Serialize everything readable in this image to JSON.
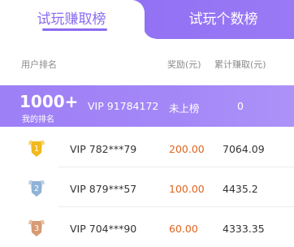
{
  "tabs": {
    "active_label": "试玩赚取榜",
    "inactive_label": "试玩个数榜"
  },
  "header": {
    "user_rank": "用户排名",
    "reward": "奖励(元)",
    "total": "累计赚取(元)"
  },
  "me": {
    "rank": "1000+",
    "rank_sub": "我的排名",
    "name": "VIP 91784172",
    "reward": "未上榜",
    "total": "0"
  },
  "rows": [
    {
      "rank": "1",
      "name": "VIP 782***79",
      "reward": "200.00",
      "total": "7064.09",
      "medal_color": "#f2b81d"
    },
    {
      "rank": "2",
      "name": "VIP 879***57",
      "reward": "100.00",
      "total": "4435.2",
      "medal_color": "#8fb2d6"
    },
    {
      "rank": "3",
      "name": "VIP 704***90",
      "reward": "60.00",
      "total": "4333.35",
      "medal_color": "#d79a74"
    }
  ],
  "colors": {
    "accent": "#8a6cf0",
    "reward": "#e0651f"
  }
}
